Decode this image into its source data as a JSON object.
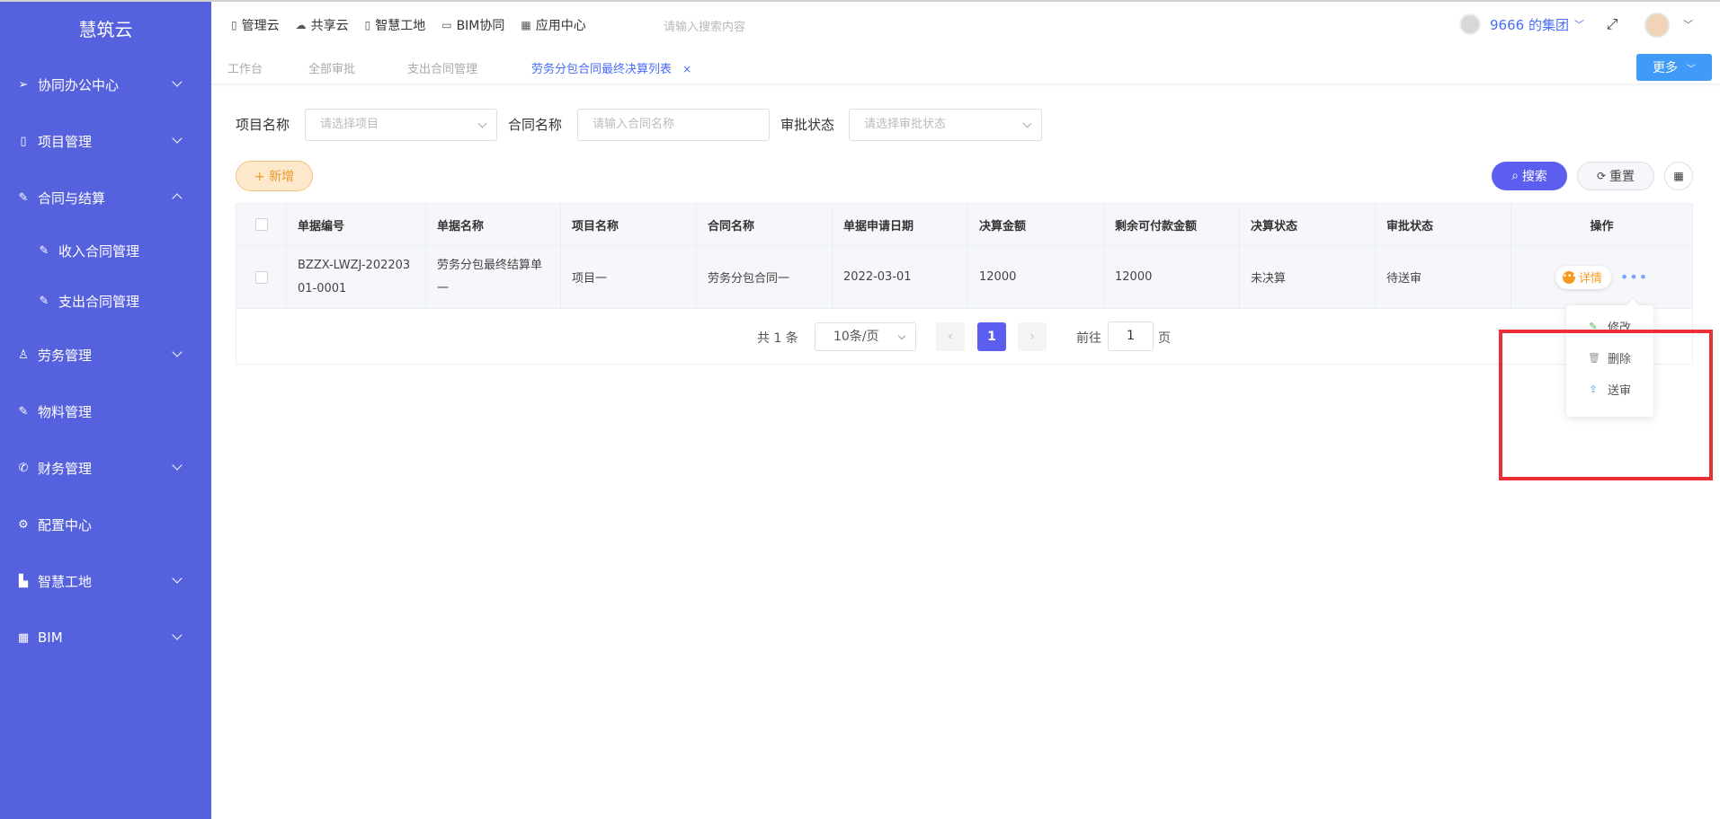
{
  "sidebar": {
    "brand": "慧筑云",
    "items": [
      {
        "label": "协同办公中心",
        "icon": "send-icon"
      },
      {
        "label": "项目管理",
        "icon": "book-icon"
      },
      {
        "label": "合同与结算",
        "icon": "edit-icon"
      },
      {
        "label": "收入合同管理",
        "icon": "edit-icon"
      },
      {
        "label": "支出合同管理",
        "icon": "edit-icon"
      },
      {
        "label": "劳务管理",
        "icon": "worker-icon"
      },
      {
        "label": "物料管理",
        "icon": "edit-icon"
      },
      {
        "label": "财务管理",
        "icon": "phone-icon"
      },
      {
        "label": "配置中心",
        "icon": "gear-icon"
      },
      {
        "label": "智慧工地",
        "icon": "bar-chart-icon"
      },
      {
        "label": "BIM",
        "icon": "grid-icon"
      }
    ]
  },
  "header": {
    "nav": [
      "管理云",
      "共享云",
      "智慧工地",
      "BIM协同",
      "应用中心"
    ],
    "search_placeholder": "请输入搜索内容",
    "org": "9666 的集团"
  },
  "tabs": {
    "items": [
      "工作台",
      "全部审批",
      "支出合同管理",
      "劳务分包合同最终决算列表"
    ],
    "close": "×",
    "more": "更多"
  },
  "filters": {
    "project_label": "项目名称",
    "project_placeholder": "请选择项目",
    "contract_label": "合同名称",
    "contract_placeholder": "请输入合同名称",
    "status_label": "审批状态",
    "status_placeholder": "请选择审批状态"
  },
  "actions": {
    "add": "+ 新增",
    "search": "搜索",
    "reset": "重置"
  },
  "table": {
    "headers": [
      "单据编号",
      "单据名称",
      "项目名称",
      "合同名称",
      "单据申请日期",
      "决算金额",
      "剩余可付款金额",
      "决算状态",
      "审批状态",
      "操作"
    ],
    "rows": [
      {
        "code_line1": "BZZX-LWZJ-202203",
        "code_line2": "01-0001",
        "name_line1": "劳务分包最终结算单",
        "name_line2": "一",
        "project": "项目一",
        "contract": "劳务分包合同一",
        "date": "2022-03-01",
        "amount": "12000",
        "remaining": "12000",
        "settle_status": "未决算",
        "approve_status": "待送审",
        "detail": "详情"
      }
    ]
  },
  "pagination": {
    "total": "共 1 条",
    "page_size": "10条/页",
    "current": "1",
    "goto_label": "前往",
    "goto_value": "1",
    "page_unit": "页"
  },
  "dropdown": {
    "items": [
      {
        "label": "修改",
        "icon": "edit-icon"
      },
      {
        "label": "删除",
        "icon": "trash-icon"
      },
      {
        "label": "送审",
        "icon": "submit-icon"
      }
    ]
  },
  "colors": {
    "sidebar": "#5661de",
    "primary": "#5c5ef0",
    "accent_orange": "#f59a23",
    "highlight": "#ea2f38"
  }
}
